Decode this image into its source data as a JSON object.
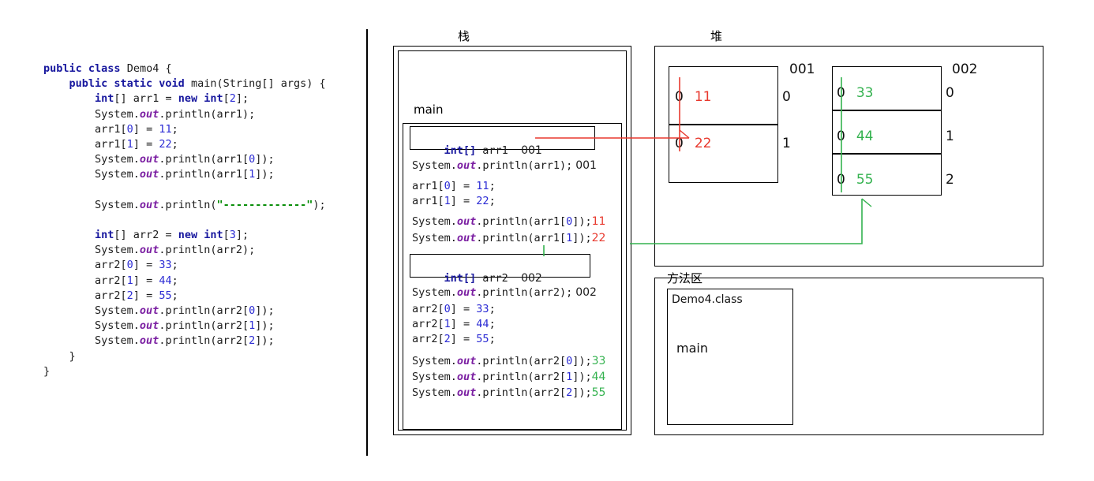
{
  "code": {
    "language": "java",
    "lines": [
      [
        {
          "t": "public ",
          "c": "kw"
        },
        {
          "t": "class ",
          "c": "kw"
        },
        {
          "t": "Demo4 {",
          "c": "pln"
        }
      ],
      [
        {
          "t": "    ",
          "c": "pln"
        },
        {
          "t": "public static void ",
          "c": "kw"
        },
        {
          "t": "main(String[] args) {",
          "c": "pln"
        }
      ],
      [
        {
          "t": "        ",
          "c": "pln"
        },
        {
          "t": "int",
          "c": "kw"
        },
        {
          "t": "[] arr1 = ",
          "c": "pln"
        },
        {
          "t": "new int",
          "c": "kw"
        },
        {
          "t": "[",
          "c": "pln"
        },
        {
          "t": "2",
          "c": "num"
        },
        {
          "t": "];",
          "c": "pln"
        }
      ],
      [
        {
          "t": "        System.",
          "c": "pln"
        },
        {
          "t": "out",
          "c": "fld"
        },
        {
          "t": ".println(arr1);",
          "c": "pln"
        }
      ],
      [
        {
          "t": "        arr1[",
          "c": "pln"
        },
        {
          "t": "0",
          "c": "num"
        },
        {
          "t": "] = ",
          "c": "pln"
        },
        {
          "t": "11",
          "c": "num"
        },
        {
          "t": ";",
          "c": "pln"
        }
      ],
      [
        {
          "t": "        arr1[",
          "c": "pln"
        },
        {
          "t": "1",
          "c": "num"
        },
        {
          "t": "] = ",
          "c": "pln"
        },
        {
          "t": "22",
          "c": "num"
        },
        {
          "t": ";",
          "c": "pln"
        }
      ],
      [
        {
          "t": "        System.",
          "c": "pln"
        },
        {
          "t": "out",
          "c": "fld"
        },
        {
          "t": ".println(arr1[",
          "c": "pln"
        },
        {
          "t": "0",
          "c": "num"
        },
        {
          "t": "]);",
          "c": "pln"
        }
      ],
      [
        {
          "t": "        System.",
          "c": "pln"
        },
        {
          "t": "out",
          "c": "fld"
        },
        {
          "t": ".println(arr1[",
          "c": "pln"
        },
        {
          "t": "1",
          "c": "num"
        },
        {
          "t": "]);",
          "c": "pln"
        }
      ],
      [],
      [
        {
          "t": "        System.",
          "c": "pln"
        },
        {
          "t": "out",
          "c": "fld"
        },
        {
          "t": ".println(",
          "c": "pln"
        },
        {
          "t": "\"-------------\"",
          "c": "str"
        },
        {
          "t": ");",
          "c": "pln"
        }
      ],
      [],
      [
        {
          "t": "        ",
          "c": "pln"
        },
        {
          "t": "int",
          "c": "kw"
        },
        {
          "t": "[] arr2 = ",
          "c": "pln"
        },
        {
          "t": "new int",
          "c": "kw"
        },
        {
          "t": "[",
          "c": "pln"
        },
        {
          "t": "3",
          "c": "num"
        },
        {
          "t": "];",
          "c": "pln"
        }
      ],
      [
        {
          "t": "        System.",
          "c": "pln"
        },
        {
          "t": "out",
          "c": "fld"
        },
        {
          "t": ".println(arr2);",
          "c": "pln"
        }
      ],
      [
        {
          "t": "        arr2[",
          "c": "pln"
        },
        {
          "t": "0",
          "c": "num"
        },
        {
          "t": "] = ",
          "c": "pln"
        },
        {
          "t": "33",
          "c": "num"
        },
        {
          "t": ";",
          "c": "pln"
        }
      ],
      [
        {
          "t": "        arr2[",
          "c": "pln"
        },
        {
          "t": "1",
          "c": "num"
        },
        {
          "t": "] = ",
          "c": "pln"
        },
        {
          "t": "44",
          "c": "num"
        },
        {
          "t": ";",
          "c": "pln"
        }
      ],
      [
        {
          "t": "        arr2[",
          "c": "pln"
        },
        {
          "t": "2",
          "c": "num"
        },
        {
          "t": "] = ",
          "c": "pln"
        },
        {
          "t": "55",
          "c": "num"
        },
        {
          "t": ";",
          "c": "pln"
        }
      ],
      [
        {
          "t": "        System.",
          "c": "pln"
        },
        {
          "t": "out",
          "c": "fld"
        },
        {
          "t": ".println(arr2[",
          "c": "pln"
        },
        {
          "t": "0",
          "c": "num"
        },
        {
          "t": "]);",
          "c": "pln"
        }
      ],
      [
        {
          "t": "        System.",
          "c": "pln"
        },
        {
          "t": "out",
          "c": "fld"
        },
        {
          "t": ".println(arr2[",
          "c": "pln"
        },
        {
          "t": "1",
          "c": "num"
        },
        {
          "t": "]);",
          "c": "pln"
        }
      ],
      [
        {
          "t": "        System.",
          "c": "pln"
        },
        {
          "t": "out",
          "c": "fld"
        },
        {
          "t": ".println(arr2[",
          "c": "pln"
        },
        {
          "t": "2",
          "c": "num"
        },
        {
          "t": "]);",
          "c": "pln"
        }
      ],
      [
        {
          "t": "    }",
          "c": "pln"
        }
      ],
      [
        {
          "t": "}",
          "c": "pln"
        }
      ]
    ]
  },
  "regions": {
    "stack_caption": "栈",
    "heap_caption": "堆",
    "method_caption": "方法区"
  },
  "stack": {
    "frame_label": "main",
    "var1": {
      "type": "int[]",
      "name": "arr1",
      "address": "001"
    },
    "var2": {
      "type": "int[]",
      "name": "arr2",
      "address": "002"
    },
    "lines_after_var1": [
      {
        "code": "System.out.println(arr1);",
        "result": "001",
        "result_color": "#1c1c1c"
      },
      {
        "code": "arr1[0] = 11;",
        "result": "",
        "result_color": ""
      },
      {
        "code": "arr1[1] = 22;",
        "result": "",
        "result_color": ""
      },
      {
        "code": "System.out.println(arr1[0]);",
        "result": "11",
        "result_color": "#e8392e"
      },
      {
        "code": "System.out.println(arr1[1]);",
        "result": "22",
        "result_color": "#e8392e"
      }
    ],
    "lines_after_var2": [
      {
        "code": "System.out.println(arr2);",
        "result": "002",
        "result_color": "#1c1c1c"
      },
      {
        "code": "arr2[0] = 33;",
        "result": "",
        "result_color": ""
      },
      {
        "code": "arr2[1] = 44;",
        "result": "",
        "result_color": ""
      },
      {
        "code": "arr2[2] = 55;",
        "result": "",
        "result_color": ""
      },
      {
        "code": "System.out.println(arr2[0]);",
        "result": "33",
        "result_color": "#34b24f"
      },
      {
        "code": "System.out.println(arr2[1]);",
        "result": "44",
        "result_color": "#34b24f"
      },
      {
        "code": "System.out.println(arr2[2]);",
        "result": "55",
        "result_color": "#34b24f"
      }
    ]
  },
  "heap": {
    "array1": {
      "address_label": "001",
      "accent": "#e8392e",
      "cells": [
        {
          "index": "0",
          "default": "0",
          "value": "11"
        },
        {
          "index": "1",
          "default": "0",
          "value": "22"
        }
      ]
    },
    "array2": {
      "address_label": "002",
      "accent": "#34b24f",
      "cells": [
        {
          "index": "0",
          "default": "0",
          "value": "33"
        },
        {
          "index": "1",
          "default": "0",
          "value": "44"
        },
        {
          "index": "2",
          "default": "0",
          "value": "55"
        }
      ]
    }
  },
  "method_area": {
    "class_name": "Demo4.class",
    "method_name": "main"
  },
  "colors": {
    "red_accent": "#e8392e",
    "green_accent": "#34b24f",
    "keyword": "#17179e",
    "number": "#2b2bd4",
    "string": "#008a00",
    "field": "#7b1fa2"
  }
}
